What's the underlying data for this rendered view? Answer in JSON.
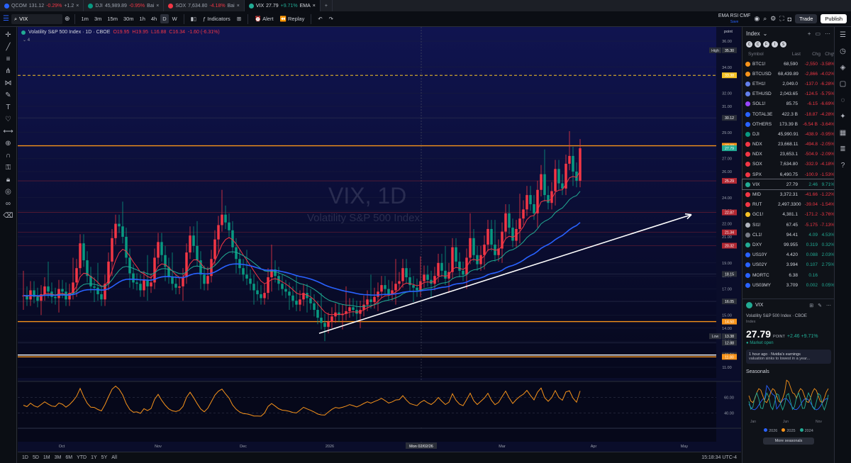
{
  "tabs": [
    {
      "symbol": "QCOM",
      "price": "131.12",
      "change": "-0.29%",
      "trail": "+1.2",
      "dir": "neg",
      "color": "#2962ff"
    },
    {
      "symbol": "DJI",
      "price": "45,989.89",
      "change": "-0.95%",
      "trail": "Bai",
      "dir": "neg",
      "color": "#089981"
    },
    {
      "symbol": "SOX",
      "price": "7,634.80",
      "change": "-4.18%",
      "trail": "Bai",
      "dir": "neg",
      "color": "#f23645"
    },
    {
      "symbol": "VIX",
      "price": "27.79",
      "change": "+9.71%",
      "trail": "EMA",
      "dir": "pos",
      "color": "#22ab94",
      "active": true
    }
  ],
  "toolbar": {
    "symbol": "VIX",
    "intervals": [
      "1m",
      "3m",
      "15m",
      "30m",
      "1h",
      "4h",
      "D",
      "W"
    ],
    "selected_interval": "D",
    "indicators": "Indicators",
    "alert": "Alert",
    "replay": "Replay",
    "layout_name": "EMA RSI CMF",
    "layout_sub": "Save",
    "trade": "Trade",
    "publish": "Publish"
  },
  "legend": {
    "title": "Volatility S&P 500 Index · 1D · CBOE",
    "open": "O19.95",
    "high": "H19.95",
    "low": "L16.88",
    "close": "C16.34",
    "change": "-1.60 (-6.31%)",
    "count": "4"
  },
  "watermark": {
    "symbol": "VIX, 1D",
    "name": "Volatility S&P 500 Index"
  },
  "price_axis": {
    "ticks": [
      "36.00",
      "34.00",
      "32.00",
      "31.00",
      "29.00",
      "27.00",
      "26.00",
      "24.00",
      "23.00",
      "22.00",
      "21.00",
      "19.00",
      "18.00",
      "17.00",
      "15.00",
      "14.00",
      "13.00",
      "11.00"
    ],
    "tags": [
      {
        "label": "High",
        "value": "35.30",
        "bg": "#2a2e39"
      },
      {
        "label": "",
        "value": "33.38",
        "bg": "#f7c325"
      },
      {
        "label": "",
        "value": "30.12",
        "bg": "#2a2e39"
      },
      {
        "label": "",
        "value": "27.98",
        "bg": "#f7931a"
      },
      {
        "label": "",
        "value": "27.79",
        "bg": "#22ab94"
      },
      {
        "label": "",
        "value": "25.29",
        "bg": "#b22833"
      },
      {
        "label": "",
        "value": "22.87",
        "bg": "#b22833"
      },
      {
        "label": "",
        "value": "21.34",
        "bg": "#b22833"
      },
      {
        "label": "",
        "value": "20.32",
        "bg": "#b22833"
      },
      {
        "label": "",
        "value": "18.15",
        "bg": "#2a2e39"
      },
      {
        "label": "",
        "value": "16.05",
        "bg": "#2a2e39"
      },
      {
        "label": "",
        "value": "14.50",
        "bg": "#f7931a"
      },
      {
        "label": "Low",
        "value": "13.38",
        "bg": "#2a2e39"
      },
      {
        "label": "",
        "value": "12.88",
        "bg": "#2a2e39"
      },
      {
        "label": "",
        "value": "11.94",
        "bg": "#2a2e39"
      },
      {
        "label": "",
        "value": "11.80",
        "bg": "#f7931a"
      }
    ],
    "point_label": "point"
  },
  "rsi_axis": {
    "ticks": [
      "60.00",
      "40.00"
    ]
  },
  "time_axis": {
    "labels": [
      "Oct",
      "Nov",
      "Dec",
      "2026",
      "Mar",
      "Apr",
      "May"
    ],
    "cursor": "Mon 02/02/26"
  },
  "bottom": {
    "ranges": [
      "1D",
      "5D",
      "1M",
      "3M",
      "6M",
      "YTD",
      "1Y",
      "5Y",
      "All"
    ],
    "clock": "15:18:34 UTC-4"
  },
  "watchlist": {
    "title": "Index",
    "columns": [
      "Symbol",
      "Last",
      "Chg",
      "Chg%"
    ],
    "icons": [
      "C",
      "C",
      "F",
      "I",
      "S"
    ],
    "rows": [
      {
        "symbol": "BTC1!",
        "last": "68,590",
        "chg": "-2,550",
        "pct": "-3.58%",
        "dir": "neg",
        "color": "#f7931a"
      },
      {
        "symbol": "BTCUSD",
        "last": "68,439.89",
        "chg": "-2,866",
        "pct": "-4.02%",
        "dir": "neg",
        "color": "#f7931a"
      },
      {
        "symbol": "ETH1!",
        "last": "2,049.0",
        "chg": "-137.0",
        "pct": "-6.28%",
        "dir": "neg",
        "color": "#627eea"
      },
      {
        "symbol": "ETHUSD",
        "last": "2,043.65",
        "chg": "-124.5",
        "pct": "-5.75%",
        "dir": "neg",
        "color": "#627eea"
      },
      {
        "symbol": "SOL1!",
        "last": "85.75",
        "chg": "-6.15",
        "pct": "-6.69%",
        "dir": "neg",
        "color": "#9945ff"
      },
      {
        "symbol": "TOTAL3E",
        "last": "422.3 B",
        "chg": "-18.87",
        "pct": "-4.28%",
        "dir": "neg",
        "color": "#2962ff"
      },
      {
        "symbol": "OTHERS",
        "last": "173.39 B",
        "chg": "-6.54 B",
        "pct": "-3.64%",
        "dir": "neg",
        "color": "#2962ff"
      },
      {
        "symbol": "DJI",
        "last": "45,990.91",
        "chg": "-438.9",
        "pct": "-0.95%",
        "dir": "neg",
        "color": "#089981"
      },
      {
        "symbol": "NDX",
        "last": "23,668.11",
        "chg": "-494.8",
        "pct": "-2.05%",
        "dir": "neg",
        "color": "#f23645"
      },
      {
        "symbol": "NDX",
        "last": "23,653.1",
        "chg": "-504.9",
        "pct": "-2.09%",
        "dir": "neg",
        "color": "#f23645"
      },
      {
        "symbol": "SOX",
        "last": "7,634.80",
        "chg": "-332.9",
        "pct": "-4.18%",
        "dir": "neg",
        "color": "#f23645"
      },
      {
        "symbol": "SPX",
        "last": "6,490.75",
        "chg": "-100.9",
        "pct": "-1.53%",
        "dir": "neg",
        "color": "#f23645"
      },
      {
        "symbol": "VIX",
        "last": "27.79",
        "chg": "2.46",
        "pct": "9.71%",
        "dir": "pos",
        "color": "#22ab94",
        "selected": true
      },
      {
        "symbol": "MID",
        "last": "3,372.31",
        "chg": "-41.66",
        "pct": "-1.22%",
        "dir": "neg",
        "color": "#f23645"
      },
      {
        "symbol": "RUT",
        "last": "2,497.3300",
        "chg": "-39.04",
        "pct": "-1.54%",
        "dir": "neg",
        "color": "#f23645"
      },
      {
        "symbol": "GC1!",
        "last": "4,381.1",
        "chg": "-171.2",
        "pct": "-3.76%",
        "dir": "neg",
        "color": "#f7c325"
      },
      {
        "symbol": "SI1!",
        "last": "67.45",
        "chg": "-5.175",
        "pct": "-7.13%",
        "dir": "neg",
        "color": "#b2b5be"
      },
      {
        "symbol": "CL1!",
        "last": "94.41",
        "chg": "4.09",
        "pct": "4.53%",
        "dir": "pos",
        "color": "#787b86"
      },
      {
        "symbol": "DXY",
        "last": "99.955",
        "chg": "0.319",
        "pct": "0.32%",
        "dir": "pos",
        "color": "#22ab94"
      },
      {
        "symbol": "US10Y",
        "last": "4.420",
        "chg": "0.088",
        "pct": "2.03%",
        "dir": "pos",
        "color": "#2962ff"
      },
      {
        "symbol": "US02Y",
        "last": "3.994",
        "chg": "0.107",
        "pct": "2.75%",
        "dir": "pos",
        "color": "#2962ff"
      },
      {
        "symbol": "MORTC",
        "last": "6.38",
        "chg": "0.16",
        "pct": "",
        "dir": "pos",
        "color": "#2962ff"
      },
      {
        "symbol": "US03MY",
        "last": "3.709",
        "chg": "0.002",
        "pct": "0.05%",
        "dir": "pos",
        "color": "#2962ff"
      }
    ]
  },
  "detail": {
    "symbol": "VIX",
    "name": "Volatility S&P 500 Index · CBOE",
    "type": "Index",
    "price": "27.79",
    "unit": "POINT",
    "change": "+2.46 +9.71%",
    "market": "● Market open",
    "news_time": "1 hour ago · Nvidia's earnings",
    "news_text": "valuation sinks to lowest in a year...",
    "seasonals_title": "Seasonals",
    "seasonal_x": [
      "Jan",
      "Jun",
      "Nov"
    ],
    "seasonal_years": [
      {
        "year": "2026",
        "color": "#2962ff"
      },
      {
        "year": "2025",
        "color": "#f7931a"
      },
      {
        "year": "2024",
        "color": "#22ab94"
      }
    ],
    "more": "More seasonals"
  },
  "chart_data": {
    "type": "candlestick",
    "symbol": "VIX",
    "interval": "1D",
    "x_labels": [
      "Oct",
      "Nov",
      "Dec",
      "2026",
      "Mar",
      "Apr",
      "May"
    ],
    "ylim": [
      11,
      36
    ],
    "closes": [
      16.5,
      16.2,
      16.9,
      16.4,
      16.1,
      16.6,
      17.2,
      16.8,
      16.4,
      16.3,
      17.0,
      16.8,
      16.2,
      16.7,
      17.5,
      18.6,
      20.5,
      19.2,
      18.0,
      17.2,
      17.1,
      16.6,
      16.2,
      17.4,
      19.1,
      20.9,
      22.0,
      21.8,
      21.0,
      19.4,
      18.2,
      17.5,
      17.4,
      16.9,
      17.7,
      17.2,
      17.5,
      19.4,
      20.6,
      19.6,
      18.7,
      17.9,
      17.4,
      17.1,
      17.2,
      17.9,
      19.8,
      21.1,
      20.3,
      19.2,
      18.1,
      17.4,
      18.0,
      19.3,
      20.8,
      21.9,
      22.7,
      22.1,
      21.5,
      20.2,
      19.3,
      18.6,
      18.1,
      17.8,
      17.4,
      16.9,
      16.6,
      16.3,
      16.7,
      17.9,
      18.5,
      18.0,
      17.4,
      17.0,
      16.8,
      16.5,
      16.1,
      15.8,
      16.2,
      16.7,
      16.3,
      15.9,
      15.4,
      14.8,
      14.4,
      14.1,
      14.5,
      14.9,
      15.2,
      15.0,
      15.1,
      15.3,
      15.6,
      15.4,
      15.1,
      15.4,
      15.8,
      16.2,
      16.0,
      16.4,
      16.8,
      17.3,
      17.0,
      16.6,
      16.9,
      17.4,
      17.6,
      18.6,
      17.9,
      17.3,
      17.1,
      16.9,
      17.6,
      18.1,
      17.7,
      17.4,
      18.0,
      19.0,
      18.4,
      17.8,
      18.3,
      20.2,
      19.1,
      18.4,
      18.1,
      19.4,
      20.9,
      19.6,
      18.9,
      19.6,
      20.4,
      21.6,
      20.4,
      19.6,
      20.1,
      21.4,
      22.8,
      21.7,
      20.7,
      21.6,
      22.4,
      23.1,
      24.2,
      23.5,
      22.8,
      24.6,
      25.8,
      24.2,
      23.6,
      24.5,
      26.2,
      25.1,
      24.7,
      26.6,
      27.2,
      26.0,
      25.3,
      27.79
    ],
    "support_levels": [
      27.98,
      14.5,
      11.8,
      11.94
    ],
    "dashed_level": 33.38,
    "high": 35.3,
    "low": 13.38,
    "rsi_ticks": [
      60,
      40
    ]
  }
}
